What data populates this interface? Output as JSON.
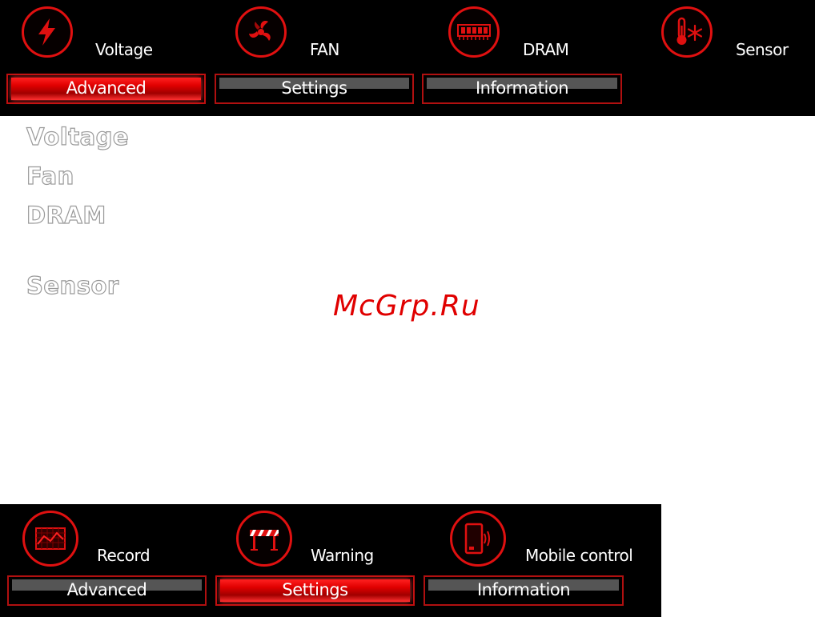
{
  "top_panel": {
    "icons": [
      {
        "label": "Voltage",
        "icon": "lightning-bolt-icon"
      },
      {
        "label": "FAN",
        "icon": "fan-icon"
      },
      {
        "label": "DRAM",
        "icon": "memory-module-icon"
      },
      {
        "label": "Sensor",
        "icon": "thermometer-snowflake-icon"
      }
    ],
    "tabs": [
      {
        "label": "Advanced",
        "active": true
      },
      {
        "label": "Settings",
        "active": false
      },
      {
        "label": "Information",
        "active": false
      }
    ]
  },
  "sections": {
    "voltage": "Voltage",
    "fan": "Fan",
    "dram": "DRAM",
    "sensor": "Sensor"
  },
  "watermark": "McGrp.Ru",
  "bottom_panel": {
    "icons": [
      {
        "label": "Record",
        "icon": "chart-record-icon"
      },
      {
        "label": "Warning",
        "icon": "barrier-warning-icon"
      },
      {
        "label": "Mobile control",
        "icon": "mobile-phone-signal-icon"
      }
    ],
    "tabs": [
      {
        "label": "Advanced",
        "active": false
      },
      {
        "label": "Settings",
        "active": true
      },
      {
        "label": "Information",
        "active": false
      }
    ]
  },
  "colors": {
    "accent": "#e01010",
    "panel_bg": "#000000",
    "tab_inactive": "#555555",
    "section_text_outline": "#9a9a9a"
  }
}
